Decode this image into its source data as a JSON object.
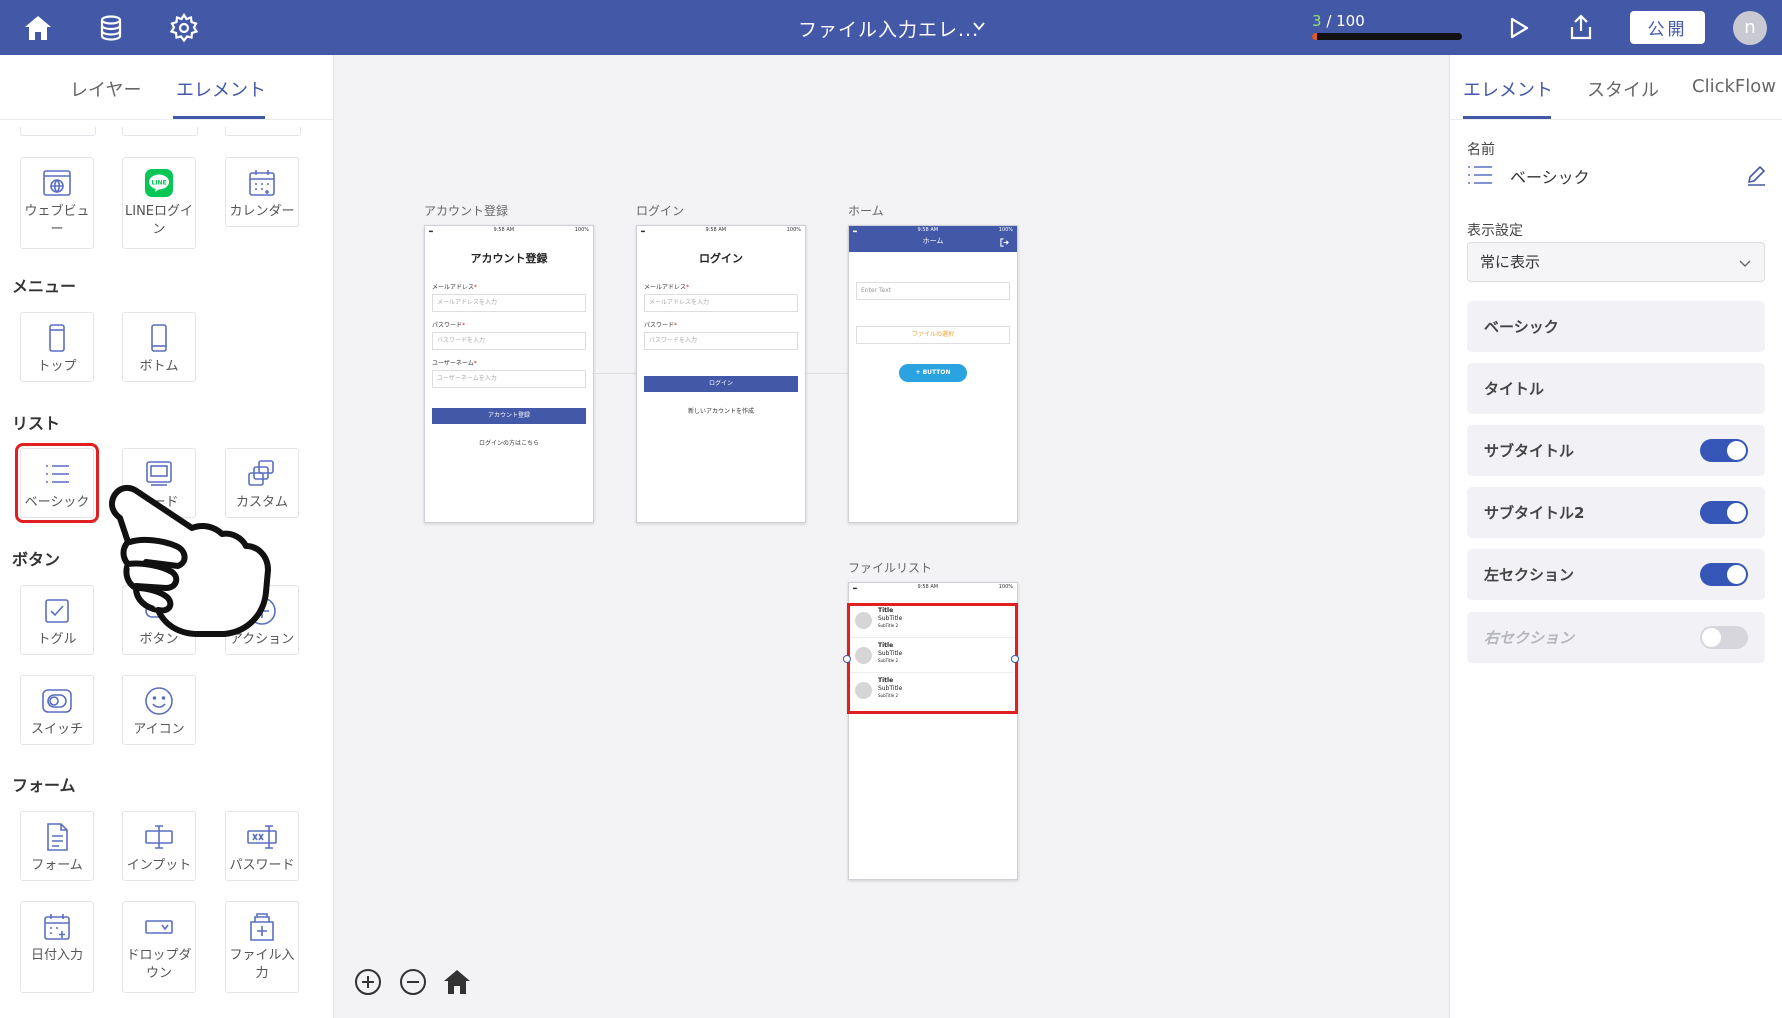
{
  "topbar": {
    "doc_title": "ファイル入力エレ...",
    "progress_current": "3",
    "progress_total": " / 100",
    "progress_fraction": 0.03,
    "publish_label": "公開",
    "avatar_letter": "n"
  },
  "left_panel": {
    "tabs": [
      "レイヤー",
      "エレメント"
    ],
    "active_tab": "エレメント",
    "top_items": [
      "ウェブビュー",
      "LINEログイン",
      "カレンダー"
    ],
    "sections": {
      "menu": "メニュー",
      "list": "リスト",
      "button": "ボタン",
      "form": "フォーム"
    },
    "menu_items": [
      "トップ",
      "ボトム"
    ],
    "list_items": [
      "ベーシック",
      "カード",
      "カスタム"
    ],
    "button_items": [
      "トグル",
      "ボタン",
      "アクション",
      "スイッチ",
      "アイコン"
    ],
    "form_items": [
      "フォーム",
      "インプット",
      "パスワード",
      "日付入力",
      "ドロップダウン",
      "ファイル入力"
    ],
    "line_badge": "LINE"
  },
  "canvas": {
    "screens": {
      "signup": {
        "label": "アカウント登録",
        "title": "アカウント登録",
        "email_label": "メールアドレス",
        "email_placeholder": "メールアドレスを入力",
        "password_label": "パスワード",
        "password_placeholder": "パスワードを入力",
        "username_label": "ユーザーネーム",
        "username_placeholder": "ユーザーネームを入力",
        "button": "アカウント登録",
        "link": "ログインの方はこちら"
      },
      "login": {
        "label": "ログイン",
        "title": "ログイン",
        "email_label": "メールアドレス",
        "email_placeholder": "メールアドレスを入力",
        "password_label": "パスワード",
        "password_placeholder": "パスワードを入力",
        "button": "ログイン",
        "link": "新しいアカウントを作成"
      },
      "home": {
        "label": "ホーム",
        "header_title": "ホーム",
        "input_placeholder": "Enter Text",
        "file_select": "ファイルの選択",
        "button": "+ BUTTON"
      },
      "filelist": {
        "label": "ファイルリスト",
        "rows": [
          {
            "title": "Title",
            "subtitle": "SubTitle",
            "subtitle2": "SubTitle 2"
          },
          {
            "title": "Title",
            "subtitle": "SubTitle",
            "subtitle2": "SubTitle 2"
          },
          {
            "title": "Title",
            "subtitle": "SubTitle",
            "subtitle2": "SubTitle 2"
          }
        ]
      }
    },
    "status_time": "9:58 AM",
    "status_battery": "100%"
  },
  "right_panel": {
    "tabs": [
      "エレメント",
      "スタイル",
      "ClickFlow"
    ],
    "active_tab": "エレメント",
    "name_label": "名前",
    "name_value": "ベーシック",
    "display_label": "表示設定",
    "display_value": "常に表示",
    "options": [
      {
        "label": "ベーシック",
        "toggle": null
      },
      {
        "label": "タイトル",
        "toggle": null
      },
      {
        "label": "サブタイトル",
        "toggle": true
      },
      {
        "label": "サブタイトル2",
        "toggle": true
      },
      {
        "label": "左セクション",
        "toggle": true
      },
      {
        "label": "右セクション",
        "toggle": false
      }
    ]
  },
  "colors": {
    "brand": "#4359a8",
    "highlight": "#e02020",
    "toggle_on": "#3556b7",
    "progress": "#e05a2c",
    "home_button": "#2aa3e0"
  }
}
